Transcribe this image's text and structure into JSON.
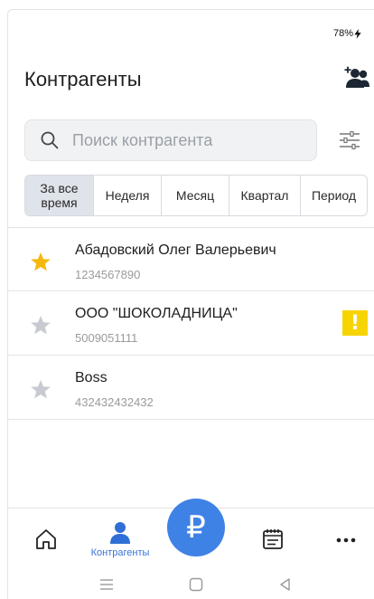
{
  "status": {
    "battery": "78%"
  },
  "header": {
    "title": "Контрагенты",
    "add_icon": "add-user-icon"
  },
  "search": {
    "placeholder": "Поиск контрагента",
    "value": ""
  },
  "periods": [
    {
      "label": "За все\nвремя",
      "active": true
    },
    {
      "label": "Неделя",
      "active": false
    },
    {
      "label": "Месяц",
      "active": false
    },
    {
      "label": "Квартал",
      "active": false
    },
    {
      "label": "Период",
      "active": false
    }
  ],
  "contractors": [
    {
      "name": "Абадовский Олег Валерьевич",
      "inn": "1234567890",
      "favorite": true,
      "warning": false
    },
    {
      "name": "ООО \"ШОКОЛАДНИЦА\"",
      "inn": "5009051111",
      "favorite": false,
      "warning": true
    },
    {
      "name": "Boss",
      "inn": "432432432432",
      "favorite": false,
      "warning": false
    }
  ],
  "tabbar": {
    "contractors_label": "Контрагенты",
    "fab_symbol": "₽"
  },
  "colors": {
    "accent": "#3f82e6",
    "star_active": "#f5b80c",
    "star_inactive": "#c7cbd1",
    "warning": "#f7d400"
  }
}
